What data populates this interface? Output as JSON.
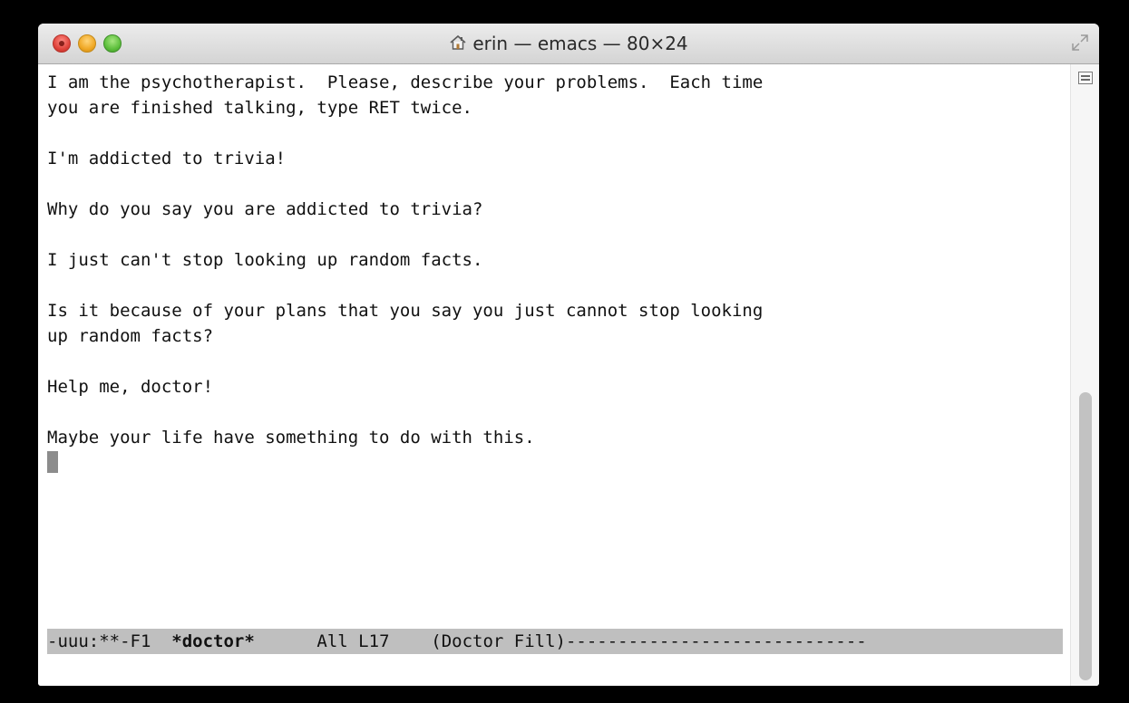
{
  "window": {
    "title": "erin — emacs — 80×24"
  },
  "buffer": {
    "lines": [
      "I am the psychotherapist.  Please, describe your problems.  Each time",
      "you are finished talking, type RET twice.",
      "",
      "I'm addicted to trivia!",
      "",
      "Why do you say you are addicted to trivia?",
      "",
      "I just can't stop looking up random facts.",
      "",
      "Is it because of your plans that you say you just cannot stop looking",
      "up random facts?",
      "",
      "Help me, doctor!",
      "",
      "Maybe your life have something to do with this.",
      ""
    ]
  },
  "modeline": {
    "status": "-uuu:**-F1  ",
    "buffer_name": "*doctor*",
    "position": "      All L17    ",
    "mode": "(Doctor Fill)",
    "filler": "-----------------------------"
  },
  "icons": {
    "home": "home-icon",
    "resize": "fullscreen-icon",
    "split": "split-window-icon"
  },
  "colors": {
    "modeline_bg": "#bfbfbf",
    "cursor": "#8c8c8c",
    "close": "#e0443c",
    "minimize": "#f0a825",
    "zoom": "#5dbf3c"
  }
}
